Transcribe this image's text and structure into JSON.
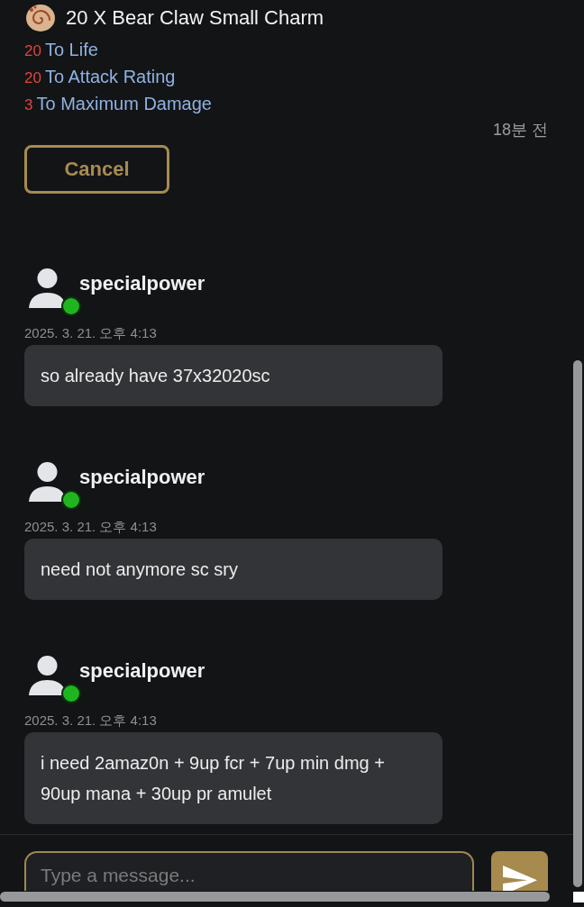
{
  "item": {
    "title": "20 X Bear Claw Small Charm",
    "stats": [
      {
        "amount": "20",
        "attribute": "To Life"
      },
      {
        "amount": "20",
        "attribute": "To Attack Rating"
      },
      {
        "amount": "3",
        "attribute": "To Maximum Damage"
      }
    ]
  },
  "time_ago": "18분 전",
  "cancel_button": {
    "label": "Cancel"
  },
  "messages": [
    {
      "author": "specialpower",
      "online": true,
      "timestamp": "2025. 3. 21. 오후 4:13",
      "text": "so already have 37x32020sc"
    },
    {
      "author": "specialpower",
      "online": true,
      "timestamp": "2025. 3. 21. 오후 4:13",
      "text": "need not anymore sc sry"
    },
    {
      "author": "specialpower",
      "online": true,
      "timestamp": "2025. 3. 21. 오후 4:13",
      "text": "i need 2amaz0n + 9up fcr + 7up min dmg + 90up mana + 30up pr amulet"
    }
  ],
  "composer": {
    "placeholder": "Type a message..."
  }
}
